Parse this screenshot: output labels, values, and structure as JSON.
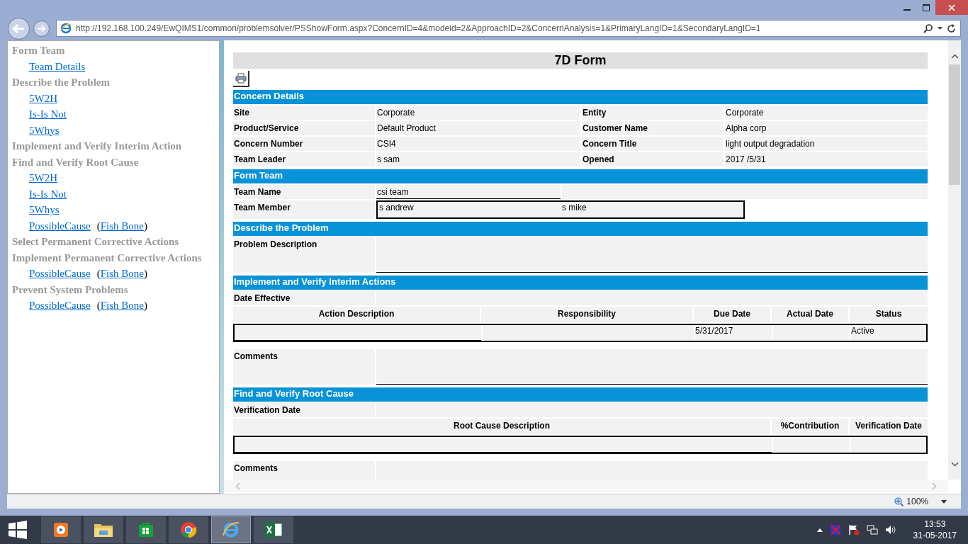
{
  "browser": {
    "url": "http://192.168.100.249/EwQIMS1/common/problemsolver/PSShowForm.aspx?ConcernID=4&modeid=2&ApproachID=2&ConcernAnalysis=1&PrimaryLangID=1&SecondaryLangID=1",
    "zoom": "100%"
  },
  "nav": [
    {
      "kind": "heading",
      "label": "Form Team"
    },
    {
      "kind": "link",
      "label": "Team Details"
    },
    {
      "kind": "heading",
      "label": "Describe the Problem"
    },
    {
      "kind": "link",
      "label": "5W2H"
    },
    {
      "kind": "link",
      "label": "Is-Is Not"
    },
    {
      "kind": "link",
      "label": "5Whys"
    },
    {
      "kind": "heading",
      "label": "Implement and Verify Interim Action"
    },
    {
      "kind": "heading",
      "label": "Find and Verify Root Cause"
    },
    {
      "kind": "link",
      "label": "5W2H"
    },
    {
      "kind": "link",
      "label": "Is-Is Not"
    },
    {
      "kind": "link",
      "label": "5Whys"
    },
    {
      "kind": "pair",
      "label": "PossibleCause",
      "open": "(",
      "extra": "Fish Bone",
      "close": ")"
    },
    {
      "kind": "heading",
      "label": "Select Permanent Corrective Actions"
    },
    {
      "kind": "heading",
      "label": "Implement Permanent Corrective Actions"
    },
    {
      "kind": "pair",
      "label": "PossibleCause",
      "open": "(",
      "extra": "Fish Bone",
      "close": ")"
    },
    {
      "kind": "heading",
      "label": "Prevent System Problems"
    },
    {
      "kind": "pair",
      "label": "PossibleCause",
      "open": "(",
      "extra": "Fish Bone",
      "close": ")"
    }
  ],
  "form": {
    "title": "7D Form",
    "sections": [
      {
        "kind": "details",
        "title": "Concern Details",
        "rows": [
          [
            "Site",
            "Corporate",
            "Entity",
            "Corporate"
          ],
          [
            "Product/Service",
            "Default Product",
            "Customer Name",
            "Alpha corp"
          ],
          [
            "Concern Number",
            "CSI4",
            "Concern Title",
            "light output degradation"
          ],
          [
            "Team Leader",
            "s sam",
            "Opened",
            "2017 /5/31"
          ]
        ]
      },
      {
        "kind": "team",
        "title": "Form Team",
        "name_label": "Team Name",
        "name": "csi team",
        "member_label": "Team Member",
        "members": [
          "s andrew",
          "s mike"
        ]
      },
      {
        "kind": "text",
        "title": "Describe the Problem",
        "label": "Problem Description"
      },
      {
        "kind": "table",
        "title": "Implement and Verify Interim Actions",
        "date_label": "Date Effective",
        "columns": [
          "Action Description",
          "Responsibility",
          "Due Date",
          "Actual Date",
          "Status"
        ],
        "row": {
          "due_date": "5/31/2017",
          "status": "Active"
        },
        "comments_label": "Comments"
      },
      {
        "kind": "table",
        "title": "Find and Verify Root Cause",
        "date_label": "Verification Date",
        "columns": [
          "Root Cause Description",
          "%Contribution",
          "Verification Date"
        ],
        "comments_label": "Comments"
      }
    ]
  },
  "taskbar": {
    "apps": [
      {
        "kind": "media",
        "selected": false
      },
      {
        "kind": "files",
        "selected": false
      },
      {
        "kind": "store",
        "selected": false
      },
      {
        "kind": "chrome",
        "selected": false
      },
      {
        "kind": "ie",
        "selected": true
      },
      {
        "kind": "excel",
        "selected": false
      }
    ],
    "time": "13:53",
    "date": "31-05-2017"
  }
}
